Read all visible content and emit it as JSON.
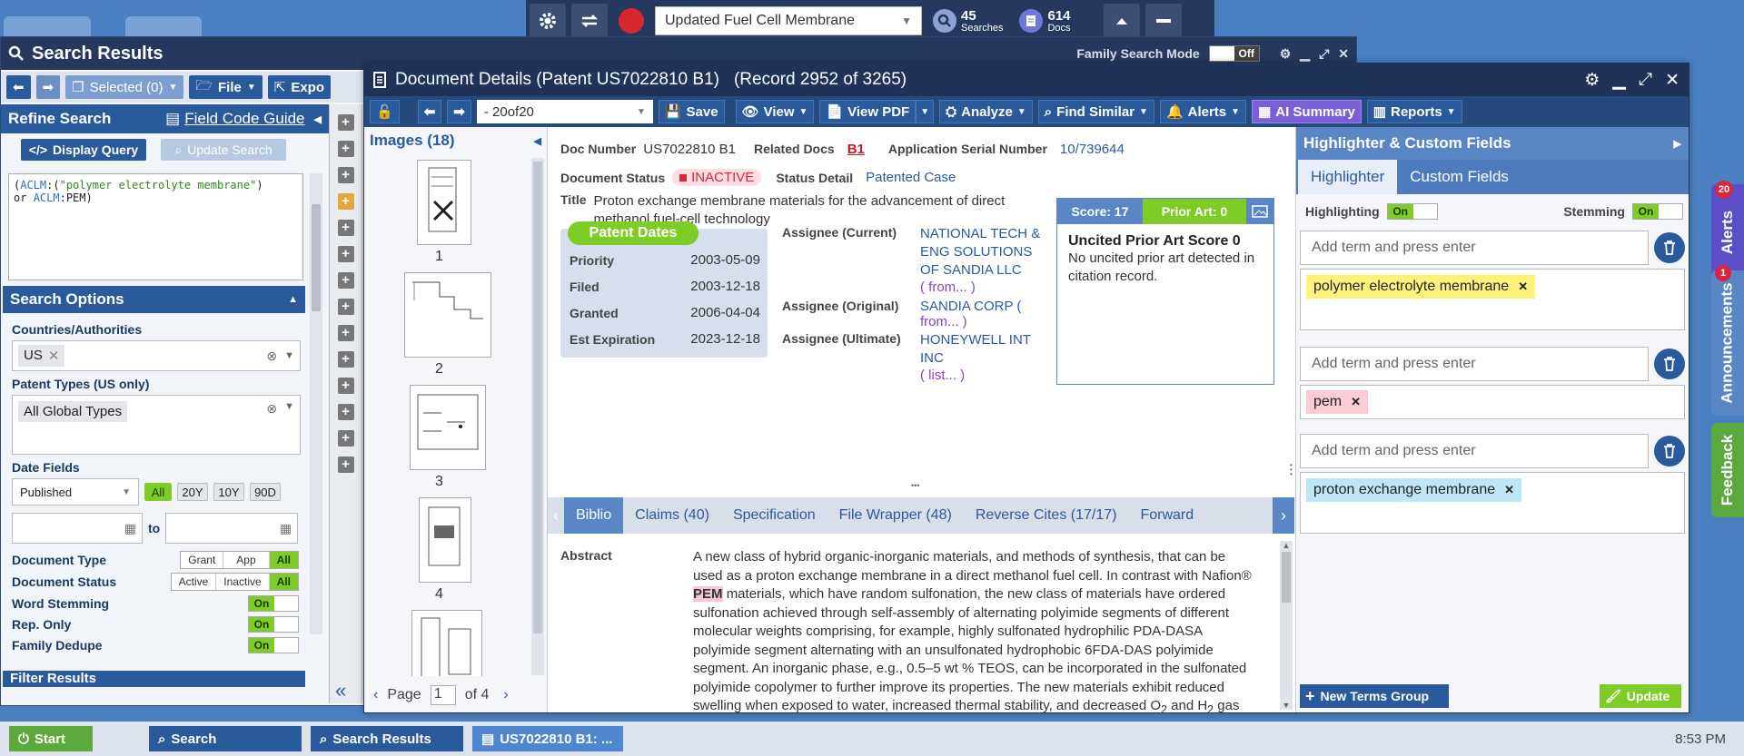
{
  "topbar": {
    "project": "Updated Fuel Cell Membrane",
    "searches_count": "45",
    "searches_label": "Searches",
    "docs_count": "614",
    "docs_label": "Docs"
  },
  "search_results": {
    "title": "Search Results",
    "family_mode_label": "Family Search Mode",
    "family_mode_value": "Off",
    "selected_label": "Selected (0)",
    "file_label": "File",
    "export_label": "Expo",
    "refine_title": "Refine Search",
    "field_code_guide": "Field Code Guide",
    "display_query": "Display Query",
    "update_search": "Update Search",
    "query": {
      "p1": "(",
      "k1": "ACLM",
      "p2": ":(",
      "s1": "\"polymer electrolyte membrane\"",
      "p3": ")",
      "p4": "or ",
      "k2": "ACLM",
      "p5": ":PEM)"
    },
    "search_options_title": "Search Options",
    "countries_label": "Countries/Authorities",
    "country_chip": "US",
    "patent_types_label": "Patent Types (US only)",
    "patent_types_chip": "All Global Types",
    "date_fields_label": "Date Fields",
    "date_field_select": "Published",
    "date_ranges": [
      "All",
      "20Y",
      "10Y",
      "90D"
    ],
    "date_to": "to",
    "document_type_label": "Document Type",
    "document_type_opts": [
      "Grant",
      "App",
      "All"
    ],
    "document_status_label": "Document Status",
    "document_status_opts": [
      "Active",
      "Inactive",
      "All"
    ],
    "word_stemming_label": "Word Stemming",
    "rep_only_label": "Rep. Only",
    "family_dedupe_label": "Family Dedupe",
    "on": "On",
    "filter_results": "Filter Results"
  },
  "document": {
    "title": "Document Details (Patent US7022810 B1)",
    "record": "(Record 2952 of 3265)",
    "doc_select": "- 20of20",
    "tools": {
      "save": "Save",
      "view": "View",
      "view_pdf": "View PDF",
      "analyze": "Analyze",
      "find_similar": "Find Similar",
      "alerts": "Alerts",
      "ai_summary": "AI Summary",
      "reports": "Reports"
    },
    "images_title": "Images (18)",
    "thumb_numbers": [
      "1",
      "2",
      "3",
      "4"
    ],
    "page_label": "Page",
    "page_value": "1",
    "page_of": "of 4",
    "doc_number_label": "Doc Number",
    "doc_number": "US7022810 B1",
    "related_docs_label": "Related Docs",
    "related_docs": "B1",
    "app_serial_label": "Application Serial Number",
    "app_serial": "10/739644",
    "doc_status_label": "Document Status",
    "doc_status": "INACTIVE",
    "status_detail_label": "Status Detail",
    "status_detail": "Patented Case",
    "title_label": "Title",
    "patent_title": "Proton exchange membrane materials for the advancement of direct methanol fuel-cell technology",
    "patent_dates_label": "Patent Dates",
    "dates": [
      {
        "label": "Priority",
        "value": "2003-05-09"
      },
      {
        "label": "Filed",
        "value": "2003-12-18"
      },
      {
        "label": "Granted",
        "value": "2006-04-04"
      },
      {
        "label": "Est Expiration",
        "value": "2023-12-18"
      }
    ],
    "assignee_current_label": "Assignee (Current)",
    "assignee_current": "NATIONAL TECH & ENG SOLUTIONS OF SANDIA LLC",
    "assignee_current_from": "( from... )",
    "assignee_original_label": "Assignee (Original)",
    "assignee_original": "SANDIA CORP (",
    "assignee_original_from": "from... )",
    "assignee_ultimate_label": "Assignee (Ultimate)",
    "assignee_ultimate": "HONEYWELL INT INC",
    "assignee_ultimate_list": "( list... )",
    "score_label": "Score: 17",
    "prior_art_label": "Prior Art: 0",
    "uncited_title": "Uncited Prior Art Score 0",
    "uncited_text": "No uncited prior art detected in citation record.",
    "tabs": [
      "Biblio",
      "Claims (40)",
      "Specification",
      "File Wrapper (48)",
      "Reverse Cites (17/17)",
      "Forward Cite"
    ],
    "abstract_label": "Abstract",
    "abstract_1": "A new class of hybrid organic-inorganic materials, and methods of synthesis, that can be used as a proton exchange membrane in a direct methanol fuel cell. In contrast with Nafion®",
    "abstract_pem": "PEM",
    "abstract_2": "materials, which have random sulfonation, the new class of materials have ordered sulfonation achieved through self-assembly of alternating polyimide segments of different molecular weights comprising, for example, highly sulfonated hydrophilic PDA-DASA polyimide segment alternating with an unsulfonated hydrophobic 6FDA-DAS polyimide segment. An inorganic phase, e.g., 0.5–5 wt % TEOS, can be incorporated in the sulfonated polyimide copolymer to further improve its properties. The new materials exhibit reduced swelling when exposed to water, increased thermal stability, and decreased O",
    "abstract_sub1": "2",
    "abstract_3": " and H",
    "abstract_sub2": "2",
    "abstract_4": " gas permeability, while retaining proton conductivities similar to Nafion®. These improved properties may allow direct methanol fuel cells to operate at higher temperatures and with higher efficiencies due to reduced methanol"
  },
  "highlighter": {
    "title": "Highlighter & Custom Fields",
    "tab_highlighter": "Highlighter",
    "tab_custom": "Custom Fields",
    "highlighting_label": "Highlighting",
    "stemming_label": "Stemming",
    "on": "On",
    "placeholder": "Add term and press enter",
    "terms": [
      {
        "text": "polymer electrolyte membrane",
        "color": "#fff27a"
      },
      {
        "text": "pem",
        "color": "#f9ccd6"
      },
      {
        "text": "proton exchange membrane",
        "color": "#bfe6f7"
      }
    ],
    "new_group": "New Terms Group",
    "update": "Update"
  },
  "side_tabs": {
    "alerts": "Alerts",
    "alerts_badge": "20",
    "announcements": "Announcements",
    "announcements_badge": "1",
    "feedback": "Feedback"
  },
  "taskbar": {
    "start": "Start",
    "search": "Search",
    "search_results": "Search Results",
    "doc": "US7022810 B1: ...",
    "time": "8:53 PM"
  }
}
